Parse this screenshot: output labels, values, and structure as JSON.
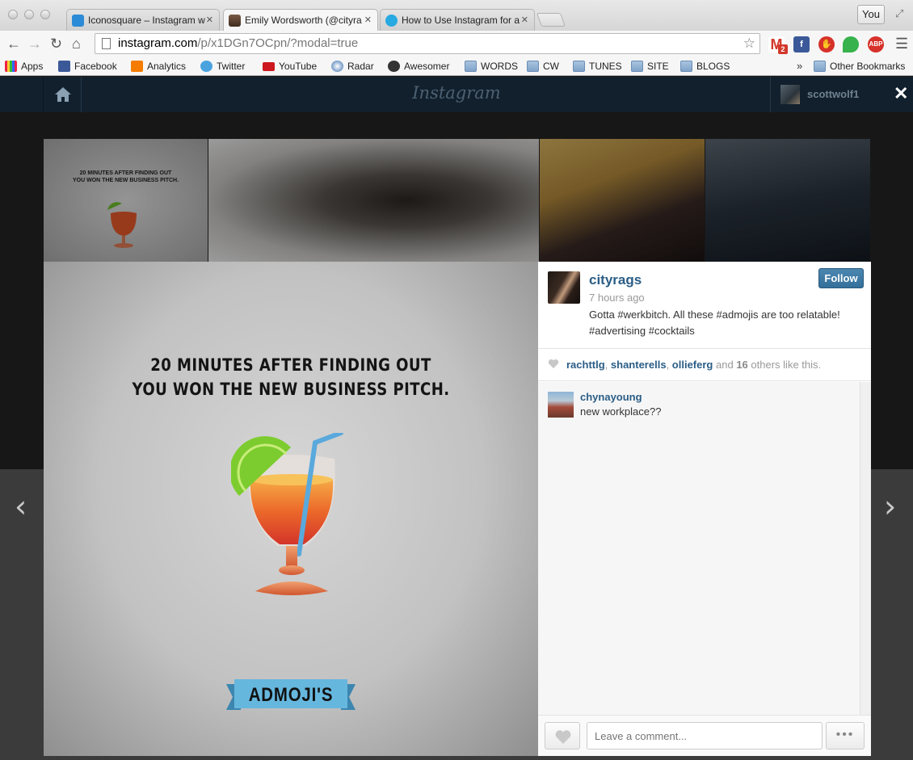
{
  "browser": {
    "tabs": [
      {
        "label": "Iconosquare – Instagram w",
        "active": false
      },
      {
        "label": "Emily Wordsworth (@cityra",
        "active": true
      },
      {
        "label": "How to Use Instagram for a",
        "active": false
      }
    ],
    "profile_button": "You",
    "url_host": "instagram.com",
    "url_path": "/p/x1DGn7OCpn/?modal=true",
    "extension_badge": "2",
    "extension_abp": "ABP",
    "bookmarks": [
      "Apps",
      "Facebook",
      "Analytics",
      "Twitter",
      "YouTube",
      "Radar",
      "Awesomer",
      "WORDS",
      "CW",
      "TUNES",
      "SITE",
      "BLOGS"
    ],
    "bookmarks_overflow": "»",
    "other_bookmarks": "Other Bookmarks"
  },
  "instagram": {
    "logo": "Instagram",
    "current_user": "scottwolf1",
    "close_glyph": "✕",
    "prev_glyph": "‹",
    "next_glyph": "›"
  },
  "photo": {
    "title_line1": "20 MINUTES AFTER FINDING OUT",
    "title_line2": "YOU WON THE NEW BUSINESS PITCH.",
    "banner_text": "ADMOJI'S",
    "thumb_line1": "20 MINUTES AFTER FINDING OUT",
    "thumb_line2": "YOU WON THE NEW BUSINESS PITCH."
  },
  "post": {
    "owner": "cityrags",
    "time": "7 hours ago",
    "caption_line1": "Gotta #werkbitch. All these #admojis are too relatable!",
    "caption_line2": "#advertising #cocktails",
    "follow_label": "Follow",
    "likers": [
      "racht­tlg",
      "shanterells",
      "ollieferg"
    ],
    "likes_and": "and",
    "likes_count": "16",
    "likes_suffix": "others like this.",
    "comments": [
      {
        "user": "chynayoung",
        "text": "new workplace??"
      }
    ],
    "comment_placeholder": "Leave a comment...",
    "more_label": "•••"
  },
  "colors": {
    "ig_header": "#12202d",
    "link_blue": "#2a5d86",
    "follow_blue": "#3d7aa5"
  }
}
